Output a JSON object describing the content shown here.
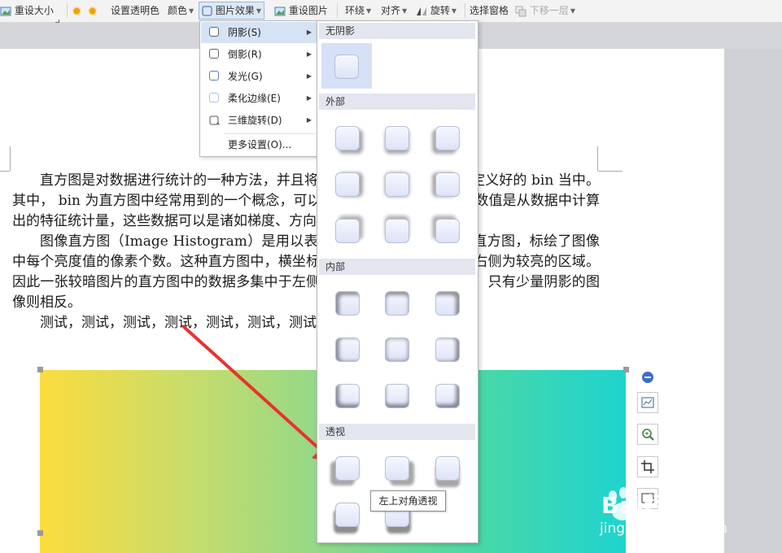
{
  "toolbar": {
    "reset_size": "重设大小",
    "set_transparent": "设置透明色",
    "color": "颜色",
    "picture_effects": "图片效果",
    "reset_picture": "重设图片",
    "wrap": "环绕",
    "align": "对齐",
    "rotate": "旋转",
    "selection_pane": "选择窗格",
    "send_backward": "下移一层"
  },
  "effects_menu": {
    "items": [
      {
        "label": "阴影(S)"
      },
      {
        "label": "倒影(R)"
      },
      {
        "label": "发光(G)"
      },
      {
        "label": "柔化边缘(E)"
      },
      {
        "label": "三维旋转(D)"
      }
    ],
    "more": "更多设置(O)..."
  },
  "shadow_gallery": {
    "sections": {
      "none": "无阴影",
      "outer": "外部",
      "inner": "内部",
      "perspective": "透视"
    },
    "tooltip": "左上对角透视"
  },
  "document": {
    "paragraphs": [
      "直方图是对数据进行统计的一种方法，并且将统计值组织到一系列实现定义好的 bin 当中。其中， bin 为直方图中经常用到的一个概念，可以译为“直条”或“组距”，其数值是从数据中计算出的特征统计量，这些数据可以是诸如梯度、方向、色彩或任何其他特征。",
      "图像直方图（Image Histogram）是用以表示数字图像中亮度分布的直方图，标绘了图像中每个亮度值的像素个数。这种直方图中，横坐标的左侧为较暗的区域，而右侧为较亮的区域。因此一张较暗图片的直方图中的数据多集中于左侧和中间部分，而整体明亮、只有少量阴影的图像则相反。",
      "测试，测试，测试，测试，测试，测试，测试"
    ]
  },
  "watermark": {
    "brand": "Bai经验",
    "url": "jingyan.baidu.com"
  },
  "colors": {
    "accent": "#d6e3f4",
    "arrow": "#e8322f"
  }
}
